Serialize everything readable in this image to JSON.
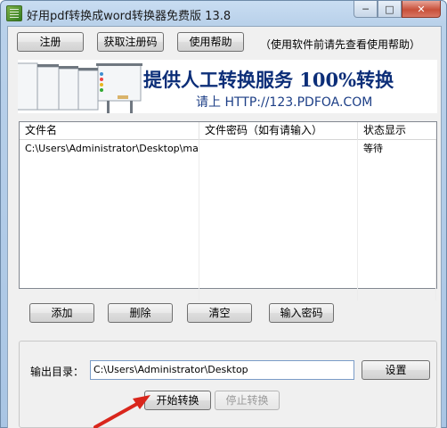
{
  "window": {
    "title": "好用pdf转换成word转换器免费版 13.8",
    "minimize_glyph": "─",
    "maximize_glyph": "□",
    "close_glyph": "✕"
  },
  "toolbar": {
    "register_label": "注册",
    "get_code_label": "获取注册码",
    "help_label": "使用帮助",
    "help_note": "（使用软件前请先查看使用帮助）"
  },
  "banner": {
    "headline": "提供人工转换服务 100%转换",
    "subline": "请上  HTTP://123.PDFOA.COM"
  },
  "file_list": {
    "columns": [
      "文件名",
      "文件密码（如有请输入）",
      "状态显示"
    ],
    "rows": [
      [
        "C:\\Users\\Administrator\\Desktop\\manu...",
        "",
        "等待"
      ]
    ]
  },
  "actions": {
    "add_label": "添加",
    "delete_label": "删除",
    "clear_label": "清空",
    "password_label": "输入密码"
  },
  "output": {
    "label": "输出目录：",
    "path": "C:\\Users\\Administrator\\Desktop",
    "settings_label": "设置",
    "start_label": "开始转换",
    "stop_label": "停止转换"
  },
  "colors": {
    "banner_text": "#0c2e78",
    "annotation_arrow": "#d9261c",
    "close_button": "#c8503a"
  }
}
